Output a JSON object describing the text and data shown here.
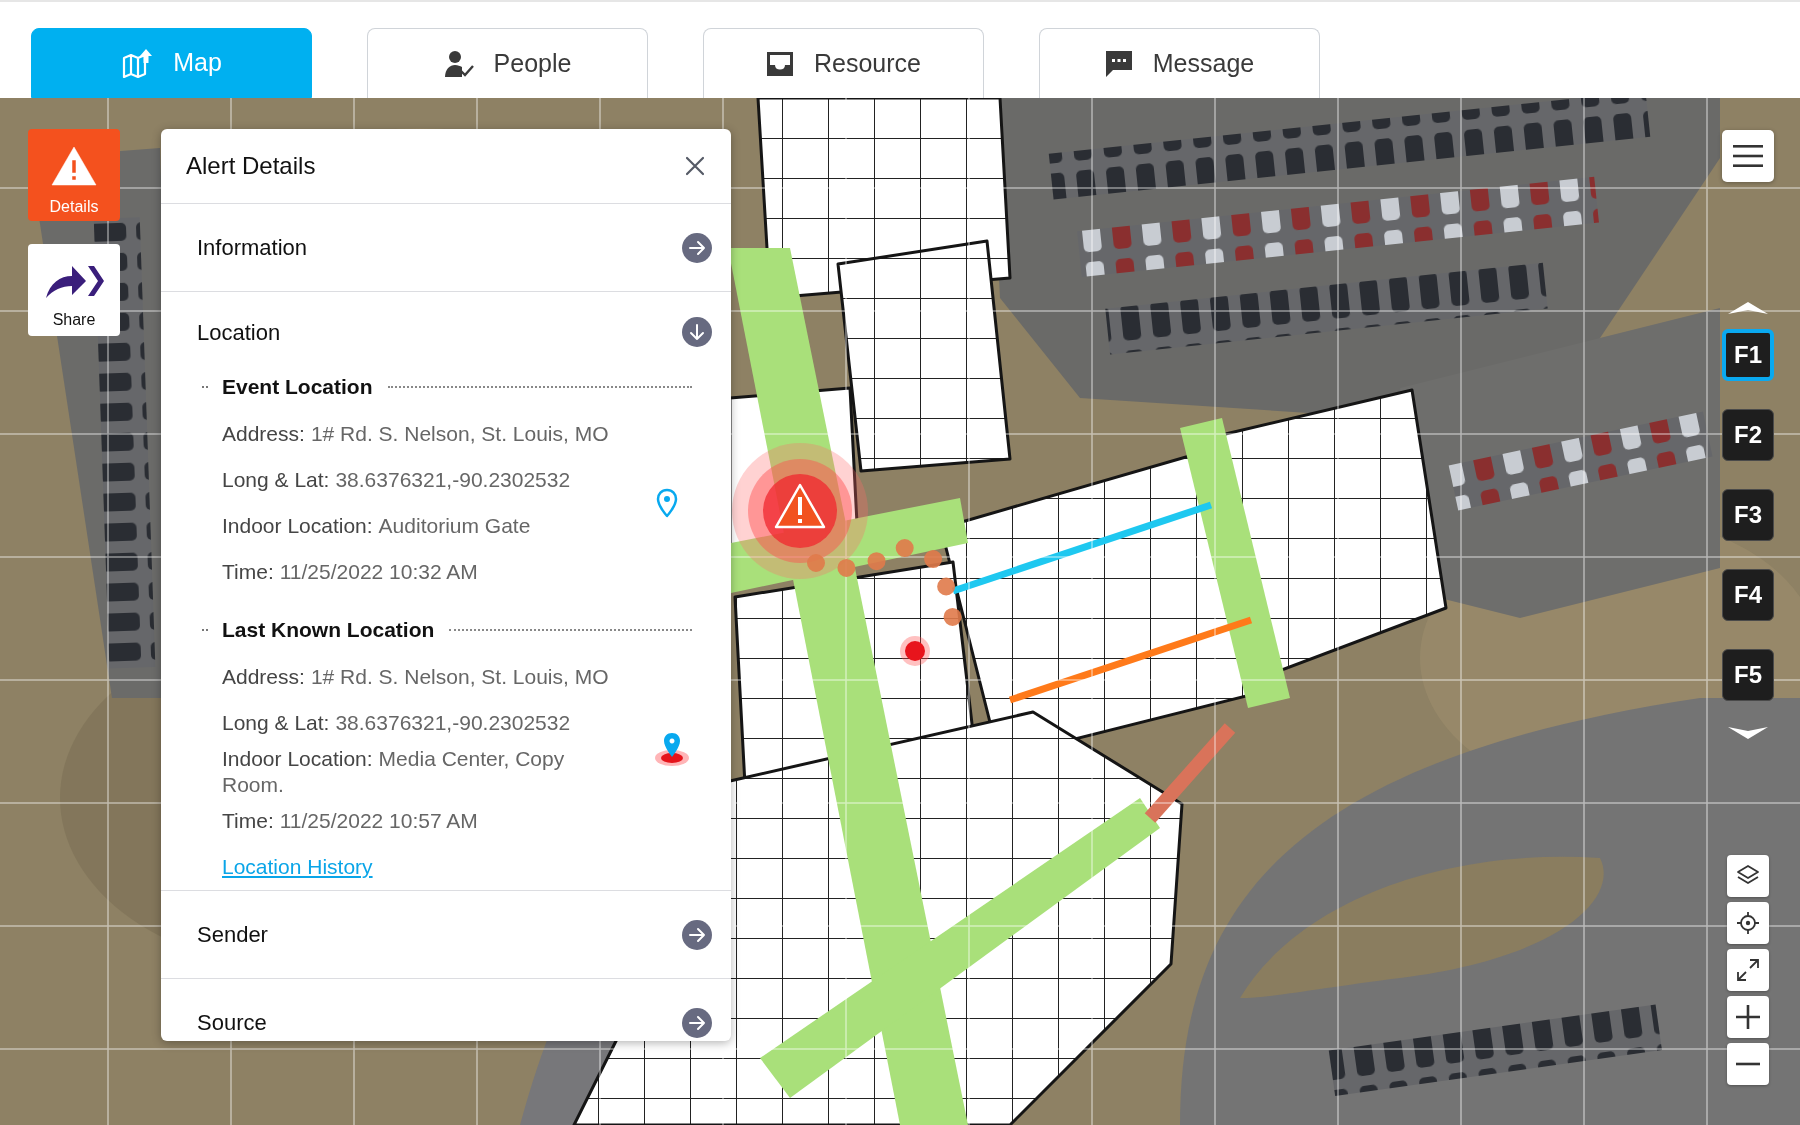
{
  "tabs": [
    {
      "label": "Map",
      "selected": true
    },
    {
      "label": "People",
      "selected": false
    },
    {
      "label": "Resource",
      "selected": false
    },
    {
      "label": "Message",
      "selected": false
    }
  ],
  "map_actions": [
    {
      "kind": "alert",
      "label": "Details"
    },
    {
      "kind": "share",
      "label": "Share"
    }
  ],
  "alert_details": {
    "title": "Alert Details",
    "sections": [
      {
        "title": "Information",
        "expanded": false
      },
      {
        "title": "Location",
        "expanded": true,
        "groups": [
          {
            "kind": "event",
            "title": "Event Location",
            "fields": [
              {
                "label": "Address:",
                "value": "1# Rd. S. Nelson, St. Louis, MO"
              },
              {
                "label": "Long & Lat:",
                "value": "38.6376321,-90.2302532"
              },
              {
                "label": "Indoor Location:",
                "value": "Auditorium Gate"
              },
              {
                "label": "Time:",
                "value": "11/25/2022 10:32 AM"
              }
            ]
          },
          {
            "kind": "last_known",
            "title": "Last Known Location",
            "fields": [
              {
                "label": "Address:",
                "value": "1# Rd. S. Nelson, St. Louis, MO"
              },
              {
                "label": "Long & Lat:",
                "value": "38.6376321,-90.2302532"
              },
              {
                "label": "Indoor Location:",
                "value": "Media Center, Copy Room."
              },
              {
                "label": "Time:",
                "value": "11/25/2022 10:57 AM"
              }
            ]
          }
        ],
        "link": "Location History"
      },
      {
        "title": "Sender",
        "expanded": false
      },
      {
        "title": "Source",
        "expanded": false
      }
    ]
  },
  "floors": [
    {
      "label": "F1",
      "selected": true
    },
    {
      "label": "F2",
      "selected": false
    },
    {
      "label": "F3",
      "selected": false
    },
    {
      "label": "F4",
      "selected": false
    },
    {
      "label": "F5",
      "selected": false
    }
  ]
}
